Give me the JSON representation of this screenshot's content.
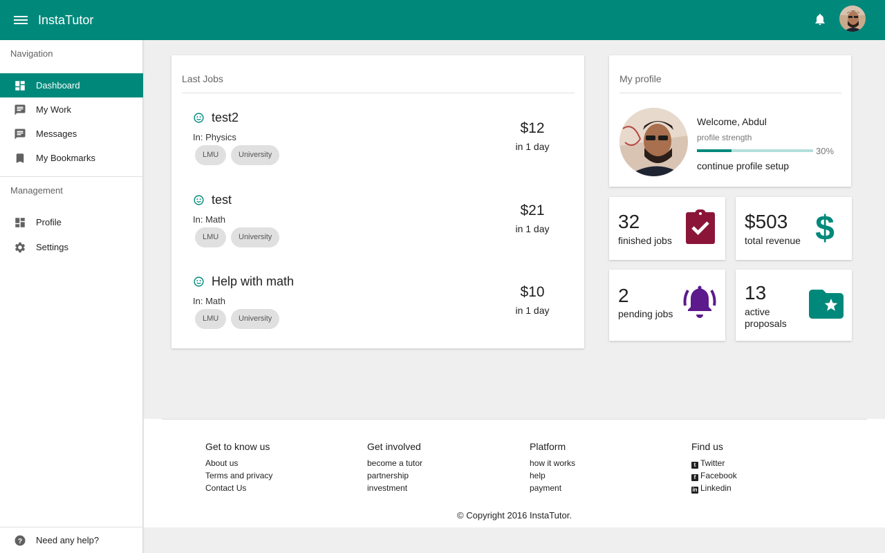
{
  "app": {
    "title": "InstaTutor"
  },
  "colors": {
    "primary": "#00897b",
    "clipboard": "#8b1538",
    "dollar": "#00897b",
    "bell": "#5c1a8c",
    "folder": "#00897b"
  },
  "sidebar": {
    "navigation_title": "Navigation",
    "management_title": "Management",
    "nav_items": [
      {
        "label": "Dashboard",
        "icon": "dashboard-icon",
        "active": true
      },
      {
        "label": "My Work",
        "icon": "chat-icon"
      },
      {
        "label": "Messages",
        "icon": "chat-icon"
      },
      {
        "label": "My Bookmarks",
        "icon": "bookmark-icon"
      }
    ],
    "management_items": [
      {
        "label": "Profile",
        "icon": "dashboard-icon"
      },
      {
        "label": "Settings",
        "icon": "gear-icon"
      }
    ],
    "help_label": "Need any help?"
  },
  "jobs": {
    "title": "Last Jobs",
    "items": [
      {
        "title": "test2",
        "subject": "In: Physics",
        "tags": [
          "LMU",
          "University"
        ],
        "price": "$12",
        "when": "in 1 day"
      },
      {
        "title": "test",
        "subject": "In: Math",
        "tags": [
          "LMU",
          "University"
        ],
        "price": "$21",
        "when": "in 1 day"
      },
      {
        "title": "Help with math",
        "subject": "In: Math",
        "tags": [
          "LMU",
          "University"
        ],
        "price": "$10",
        "when": "in 1 day"
      }
    ]
  },
  "profile": {
    "title": "My profile",
    "welcome": "Welcome, Abdul",
    "strength_label": "profile strength",
    "strength_percent": "30%",
    "strength_value": 0.3,
    "continue_label": "continue profile setup"
  },
  "stats": [
    {
      "value": "32",
      "label": "finished jobs",
      "icon": "clipboard-check-icon"
    },
    {
      "value": "$503",
      "label": "total revenue",
      "icon": "dollar-icon"
    },
    {
      "value": "2",
      "label": "pending jobs",
      "icon": "bell-ringing-icon"
    },
    {
      "value": "13",
      "label": "active proposals",
      "icon": "folder-star-icon"
    }
  ],
  "footer": {
    "columns": [
      {
        "title": "Get to know us",
        "links": [
          "About us",
          "Terms and privacy",
          "Contact Us"
        ]
      },
      {
        "title": "Get involved",
        "links": [
          "become a tutor",
          "partnership",
          "investment"
        ]
      },
      {
        "title": "Platform",
        "links": [
          "how it works",
          "help",
          "payment"
        ]
      },
      {
        "title": "Find us",
        "links": [
          "Twitter",
          "Facebook",
          "Linkedin"
        ]
      }
    ],
    "copyright": "© Copyright 2016 InstaTutor."
  }
}
